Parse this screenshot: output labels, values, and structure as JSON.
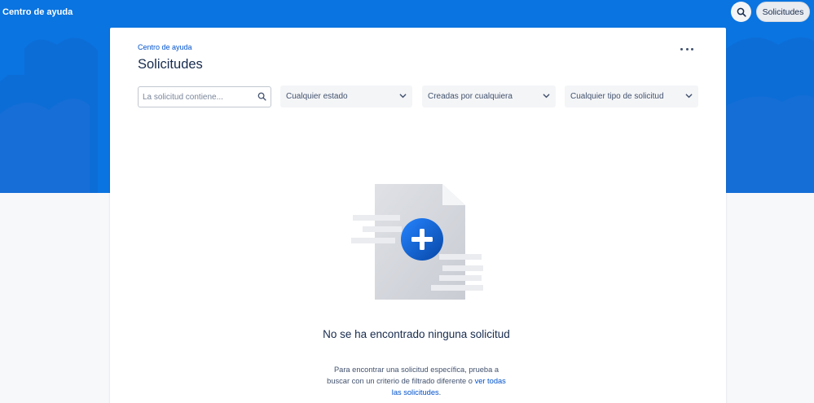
{
  "header": {
    "brand": "Centro de ayuda",
    "search_icon": "search-icon",
    "requests_button": "Solicitudes"
  },
  "panel": {
    "breadcrumb": "Centro de ayuda",
    "title": "Solicitudes",
    "more_icon": "more-horizontal-icon"
  },
  "filters": {
    "search_placeholder": "La solicitud contiene...",
    "status": "Cualquier estado",
    "created_by": "Creadas por cualquiera",
    "request_type": "Cualquier tipo de solicitud"
  },
  "empty_state": {
    "illustration": "document-plus-icon",
    "title": "No se ha encontrado ninguna solicitud",
    "text": "Para encontrar una solicitud específica, prueba a buscar con un criterio de filtrado diferente o ",
    "link": "ver todas las solicitudes",
    "text_end": "."
  },
  "colors": {
    "hero_blue": "#0a74e0",
    "link_blue": "#0052cc",
    "accent_icon": "#0c66e4"
  }
}
